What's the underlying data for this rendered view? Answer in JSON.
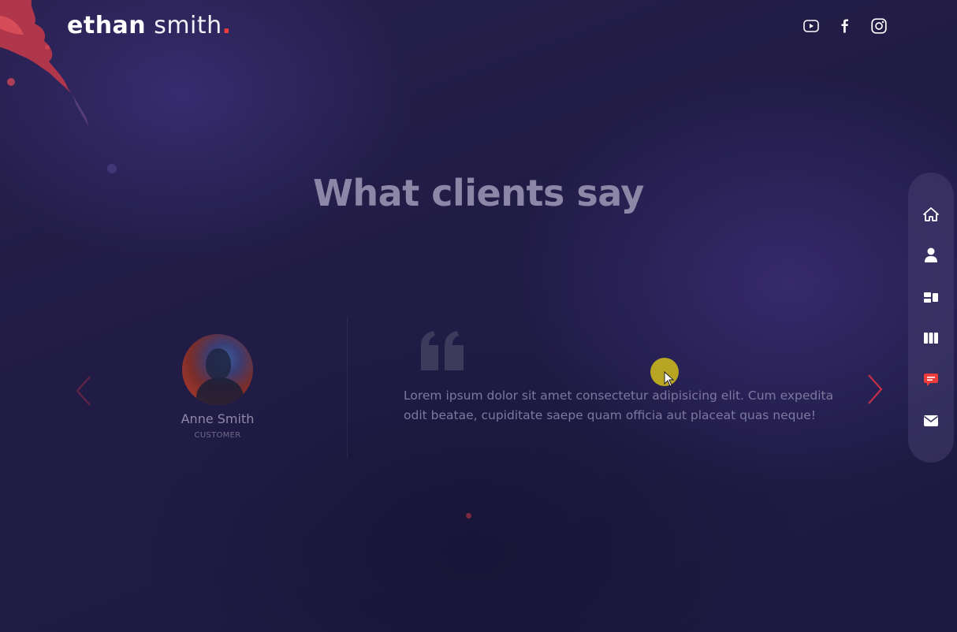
{
  "header": {
    "logo_first": "ethan",
    "logo_last": "smith",
    "logo_dot": ".",
    "socials": [
      {
        "name": "youtube-icon"
      },
      {
        "name": "facebook-icon"
      },
      {
        "name": "instagram-icon"
      }
    ]
  },
  "section": {
    "title": "What clients say"
  },
  "testimonial": {
    "name": "Anne Smith",
    "role": "CUSTOMER",
    "quote": "Lorem ipsum dolor sit amet consectetur adipisicing elit. Cum expedita odit beatae, cupiditate saepe quam officia aut placeat quas neque!"
  },
  "nav": {
    "items": [
      {
        "icon": "home-icon"
      },
      {
        "icon": "user-icon"
      },
      {
        "icon": "services-icon"
      },
      {
        "icon": "work-icon"
      },
      {
        "icon": "testimonials-icon",
        "active": true
      },
      {
        "icon": "mail-icon"
      }
    ]
  },
  "colors": {
    "accent": "#f13c3c",
    "background": "#1d1a3b",
    "title": "#8c87a7",
    "nav_bg": "#463e6e"
  }
}
